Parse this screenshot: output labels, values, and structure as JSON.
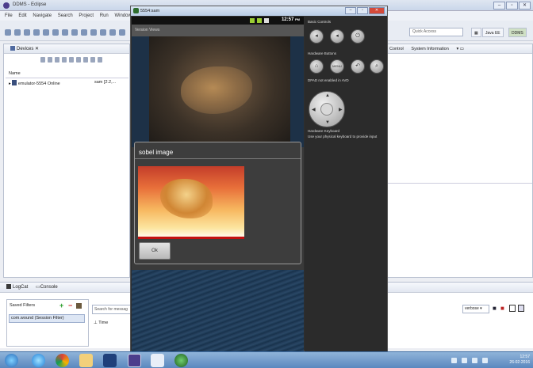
{
  "eclipse": {
    "title": "DDMS - Eclipse",
    "menu": [
      "File",
      "Edit",
      "Navigate",
      "Search",
      "Project",
      "Run",
      "Window"
    ],
    "quick_access": "Quick Access",
    "perspective_java": "Java EE",
    "perspective_ddms": "DDMS",
    "devices_tab": "Devices",
    "name_header": "Name",
    "device_name": "emulator-5554",
    "device_status": "Online",
    "device_target": "sam [2.2,...",
    "right_tabs": [
      "Control",
      "System Information"
    ],
    "logcat_tab": "LogCat",
    "console_tab": "Console",
    "saved_filters": "Saved Filters",
    "filter_item": "com.wound (Session Filter)",
    "search_placeholder": "Search for messag",
    "time_col": "Time",
    "verbose": "verbose"
  },
  "emulator": {
    "window_title": "5554:sam",
    "status_time": "12:57",
    "status_ampm": "PM",
    "app_bar": "Version Views",
    "basic_controls": "Basic Controls",
    "hardware_buttons": "Hardware Buttons",
    "dpad_note": "DPAD not enabled in AVD",
    "hardware_keyboard": "Hardware Keyboard",
    "keyboard_note": "Use your physical keyboard to provide input",
    "menu_label": "MENU"
  },
  "dialog": {
    "title": "sobel image",
    "ok_label": "Ok"
  },
  "taskbar": {
    "time": "12:57",
    "date": "26-02-2016"
  }
}
